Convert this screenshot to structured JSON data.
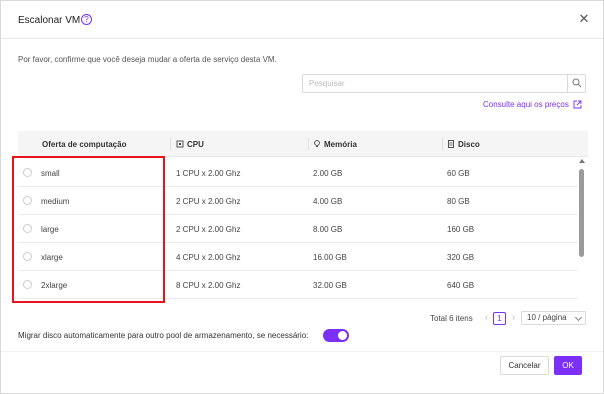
{
  "dialog": {
    "title": "Escalonar VM",
    "help_icon": "question-circle-icon",
    "close_icon": "close-icon",
    "description": "Por favor, confirme que você deseja mudar a oferta de serviço desta VM."
  },
  "search": {
    "placeholder": "Pesquisar",
    "value": "",
    "icon": "search-icon"
  },
  "prices_link": {
    "label": "Consulte aqui os preços",
    "icon": "external-link-icon"
  },
  "table": {
    "columns": [
      {
        "label": "Oferta de computação",
        "icon": ""
      },
      {
        "label": "CPU",
        "icon": "cpu-icon"
      },
      {
        "label": "Memória",
        "icon": "lightbulb-icon"
      },
      {
        "label": "Disco",
        "icon": "disk-icon"
      }
    ],
    "rows": [
      {
        "name": "small",
        "cpu": "1 CPU x 2.00 Ghz",
        "memory": "2.00 GB",
        "disk": "60 GB",
        "selected": false
      },
      {
        "name": "medium",
        "cpu": "2 CPU x 2.00 Ghz",
        "memory": "4.00 GB",
        "disk": "80 GB",
        "selected": false
      },
      {
        "name": "large",
        "cpu": "2 CPU x 2.00 Ghz",
        "memory": "8.00 GB",
        "disk": "160 GB",
        "selected": false
      },
      {
        "name": "xlarge",
        "cpu": "4 CPU x 2.00 Ghz",
        "memory": "16.00 GB",
        "disk": "320 GB",
        "selected": false
      },
      {
        "name": "2xlarge",
        "cpu": "8 CPU x 2.00 Ghz",
        "memory": "32.00 GB",
        "disk": "640 GB",
        "selected": false
      }
    ]
  },
  "pagination": {
    "total": "Total 6 itens",
    "current_page": "1",
    "page_size": "10 / página"
  },
  "migrate": {
    "label": "Migrar disco automaticamente para outro pool de armazenamento, se necessário:",
    "enabled": true
  },
  "buttons": {
    "cancel": "Cancelar",
    "ok": "OK"
  },
  "colors": {
    "accent": "#7b2ff7",
    "highlight": "#e8131b"
  }
}
